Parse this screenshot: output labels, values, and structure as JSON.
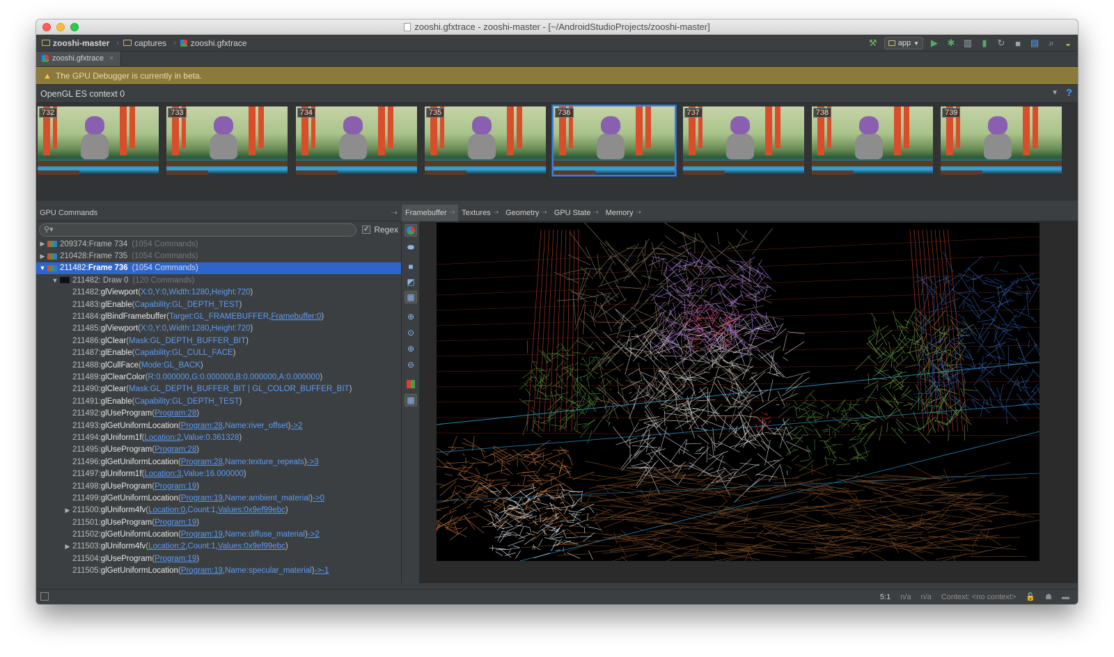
{
  "window": {
    "title": "zooshi.gfxtrace - zooshi-master - [~/AndroidStudioProjects/zooshi-master]"
  },
  "navbar": {
    "breadcrumbs": [
      "zooshi-master",
      "captures",
      "zooshi.gfxtrace"
    ],
    "run_config": "app"
  },
  "tabs": {
    "file_tab": "zooshi.gfxtrace",
    "close_glyph": "×"
  },
  "banner": {
    "text": "The GPU Debugger is currently in beta."
  },
  "context": {
    "label": "OpenGL ES context 0",
    "help": "?"
  },
  "thumbnails": [
    "732",
    "733",
    "734",
    "735",
    "736",
    "737",
    "738",
    "739"
  ],
  "thumbnails_selected": "736",
  "left_panel": {
    "title": "GPU Commands",
    "pin": "⇢",
    "regex_label": "Regex"
  },
  "right_tabs": [
    "Framebuffer",
    "Textures",
    "Geometry",
    "GPU State",
    "Memory"
  ],
  "tree": {
    "frames": [
      {
        "id": "209374:",
        "name": "Frame 734",
        "count": "(1054 Commands)"
      },
      {
        "id": "210428:",
        "name": "Frame 735",
        "count": "(1054 Commands)"
      },
      {
        "id": "211482:",
        "name": "Frame 736",
        "count": "(1054 Commands)"
      }
    ],
    "draw": {
      "id": "211482:",
      "name": "Draw 0",
      "count": "(120 Commands)"
    },
    "commands": [
      {
        "id": "211482:",
        "fn": "glViewport",
        "args": [
          [
            "X:",
            "0"
          ],
          [
            "Y:",
            "0"
          ],
          [
            "Width:",
            "1280"
          ],
          [
            "Height:",
            "720"
          ]
        ]
      },
      {
        "id": "211483:",
        "fn": "glEnable",
        "args": [
          [
            "Capability:",
            "GL_DEPTH_TEST"
          ]
        ]
      },
      {
        "id": "211484:",
        "fn": "glBindFramebuffer",
        "args": [
          [
            "Target:",
            "GL_FRAMEBUFFER"
          ],
          [
            "Framebuffer:0",
            ""
          ]
        ]
      },
      {
        "id": "211485:",
        "fn": "glViewport",
        "args": [
          [
            "X:",
            "0"
          ],
          [
            "Y:",
            "0"
          ],
          [
            "Width:",
            "1280"
          ],
          [
            "Height:",
            "720"
          ]
        ]
      },
      {
        "id": "211486:",
        "fn": "glClear",
        "args": [
          [
            "Mask:",
            "GL_DEPTH_BUFFER_BIT"
          ]
        ]
      },
      {
        "id": "211487:",
        "fn": "glEnable",
        "args": [
          [
            "Capability:",
            "GL_CULL_FACE"
          ]
        ]
      },
      {
        "id": "211488:",
        "fn": "glCullFace",
        "args": [
          [
            "Mode:",
            "GL_BACK"
          ]
        ]
      },
      {
        "id": "211489:",
        "fn": "glClearColor",
        "args": [
          [
            "R:",
            "0.000000"
          ],
          [
            "G:",
            "0.000000"
          ],
          [
            "B:",
            "0.000000"
          ],
          [
            "A:",
            "0.000000"
          ]
        ]
      },
      {
        "id": "211490:",
        "fn": "glClear",
        "args": [
          [
            "Mask:",
            "GL_DEPTH_BUFFER_BIT | GL_COLOR_BUFFER_BIT"
          ]
        ]
      },
      {
        "id": "211491:",
        "fn": "glEnable",
        "args": [
          [
            "Capability:",
            "GL_DEPTH_TEST"
          ]
        ]
      },
      {
        "id": "211492:",
        "fn": "glUseProgram",
        "args": [
          [
            "Program:28",
            ""
          ]
        ]
      },
      {
        "id": "211493:",
        "fn": "glGetUniformLocation",
        "args": [
          [
            "Program:28",
            ""
          ],
          [
            "Name:",
            "river_offset"
          ]
        ],
        "ret": "->2"
      },
      {
        "id": "211494:",
        "fn": "glUniform1f",
        "args": [
          [
            "Location:2",
            ""
          ],
          [
            "Value:",
            "0.361328"
          ]
        ]
      },
      {
        "id": "211495:",
        "fn": "glUseProgram",
        "args": [
          [
            "Program:28",
            ""
          ]
        ]
      },
      {
        "id": "211496:",
        "fn": "glGetUniformLocation",
        "args": [
          [
            "Program:28",
            ""
          ],
          [
            "Name:",
            "texture_repeats"
          ]
        ],
        "ret": "->3"
      },
      {
        "id": "211497:",
        "fn": "glUniform1f",
        "args": [
          [
            "Location:3",
            ""
          ],
          [
            "Value:",
            "16.000000"
          ]
        ]
      },
      {
        "id": "211498:",
        "fn": "glUseProgram",
        "args": [
          [
            "Program:19",
            ""
          ]
        ]
      },
      {
        "id": "211499:",
        "fn": "glGetUniformLocation",
        "args": [
          [
            "Program:19",
            ""
          ],
          [
            "Name:",
            "ambient_material"
          ]
        ],
        "ret": "->0"
      },
      {
        "id": "211500:",
        "fn": "glUniform4fv",
        "expandable": true,
        "args": [
          [
            "Location:0",
            ""
          ],
          [
            "Count:",
            "1"
          ],
          [
            "Values:0x9ef99ebc",
            ""
          ]
        ]
      },
      {
        "id": "211501:",
        "fn": "glUseProgram",
        "args": [
          [
            "Program:19",
            ""
          ]
        ]
      },
      {
        "id": "211502:",
        "fn": "glGetUniformLocation",
        "args": [
          [
            "Program:19",
            ""
          ],
          [
            "Name:",
            "diffuse_material"
          ]
        ],
        "ret": "->2"
      },
      {
        "id": "211503:",
        "fn": "glUniform4fv",
        "expandable": true,
        "args": [
          [
            "Location:2",
            ""
          ],
          [
            "Count:",
            "1"
          ],
          [
            "Values:0x9ef99ebc",
            ""
          ]
        ]
      },
      {
        "id": "211504:",
        "fn": "glUseProgram",
        "args": [
          [
            "Program:19",
            ""
          ]
        ]
      },
      {
        "id": "211505:",
        "fn": "glGetUniformLocation",
        "args": [
          [
            "Program:19",
            ""
          ],
          [
            "Name:",
            "specular_material"
          ]
        ],
        "ret": "->-1"
      }
    ]
  },
  "statusbar": {
    "position": "5:1",
    "na1": "n/a",
    "na2": "n/a",
    "context": "Context: <no context>"
  },
  "colors": {
    "selection": "#2f65ca",
    "link": "#5c9cf3",
    "banner": "#8c7a3a"
  }
}
